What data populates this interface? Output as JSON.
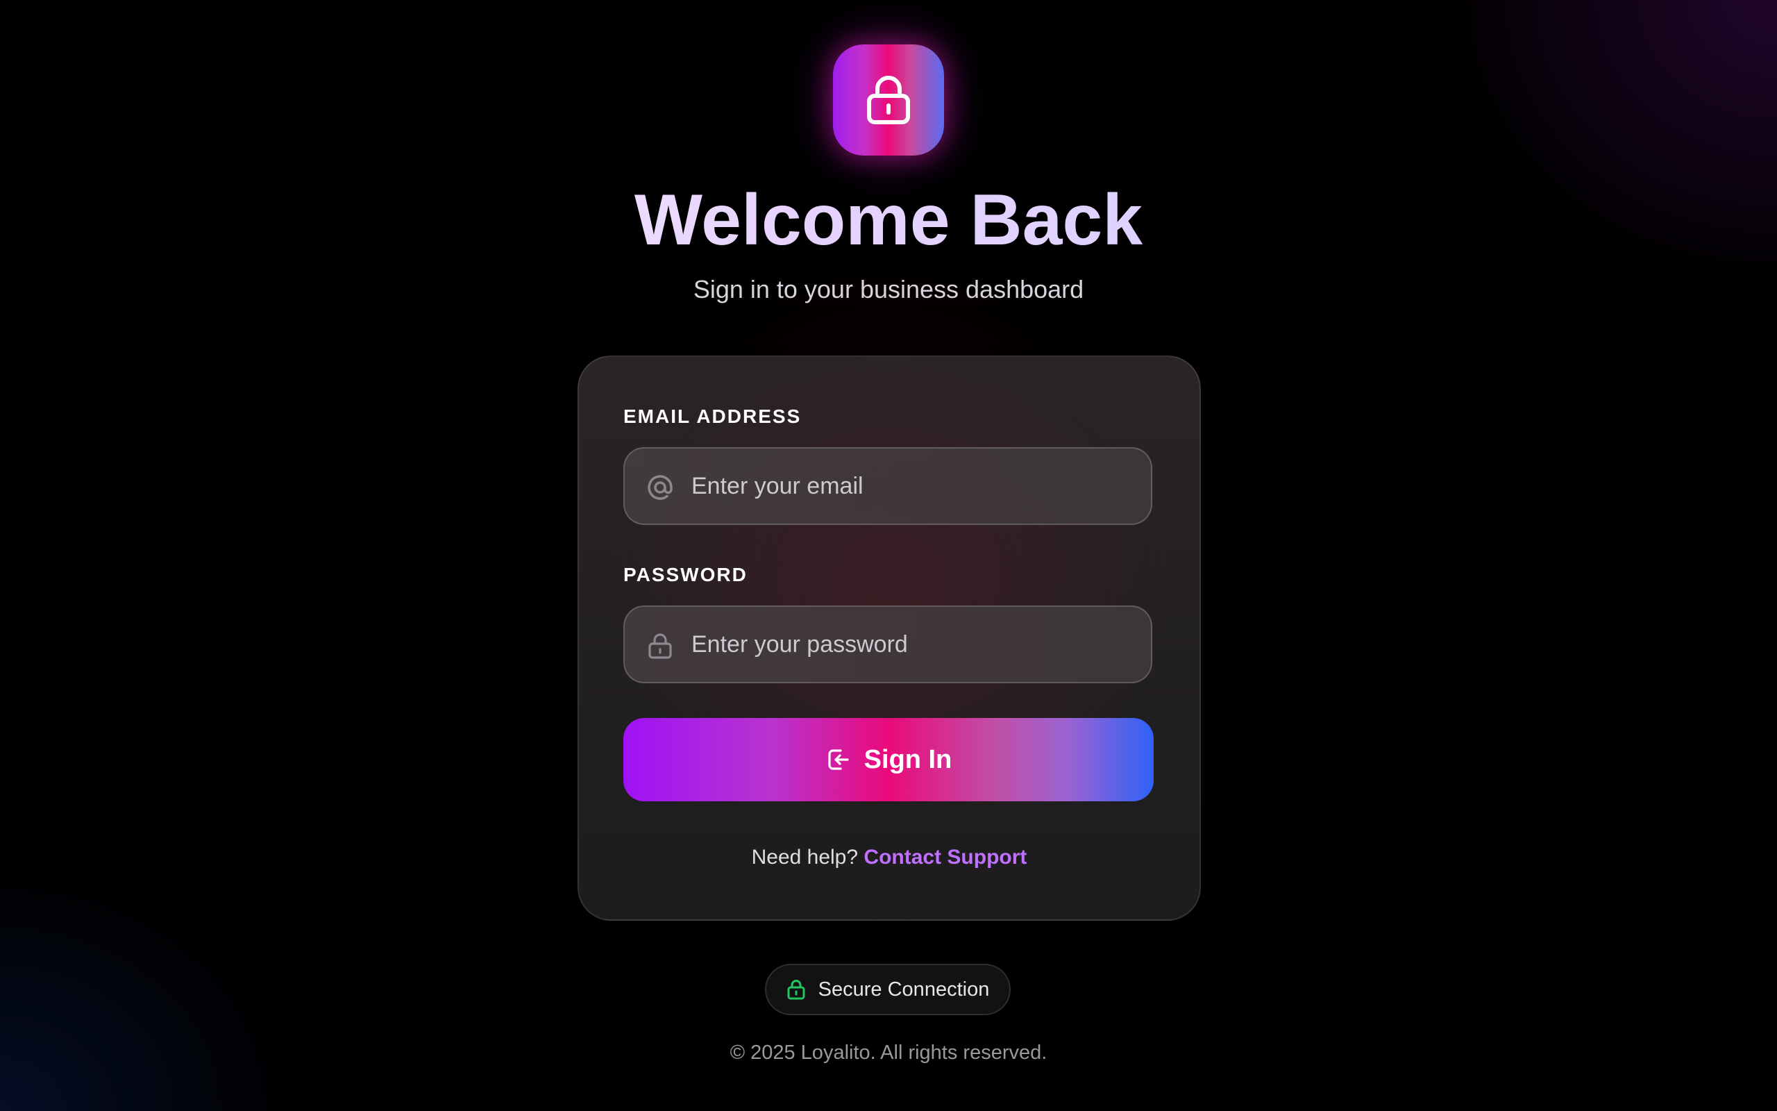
{
  "header": {
    "title": "Welcome Back",
    "subtitle": "Sign in to your business dashboard"
  },
  "form": {
    "email": {
      "label": "EMAIL ADDRESS",
      "placeholder": "Enter your email",
      "value": "",
      "icon": "at-sign-icon"
    },
    "password": {
      "label": "PASSWORD",
      "placeholder": "Enter your password",
      "value": "",
      "icon": "lock-icon"
    },
    "submit": {
      "label": "Sign In",
      "icon": "login-icon"
    },
    "help": {
      "text": "Need help?",
      "link": "Contact Support"
    }
  },
  "badge": {
    "label": "Secure Connection",
    "icon": "lock-icon",
    "color": "#22c55e"
  },
  "footer": {
    "copyright": "© 2025 Loyalito. All rights reserved."
  },
  "colors": {
    "accent_purple": "#a012f6",
    "accent_pink": "#ea0a7b",
    "accent_blue": "#2e62f6",
    "link": "#c070ff"
  }
}
